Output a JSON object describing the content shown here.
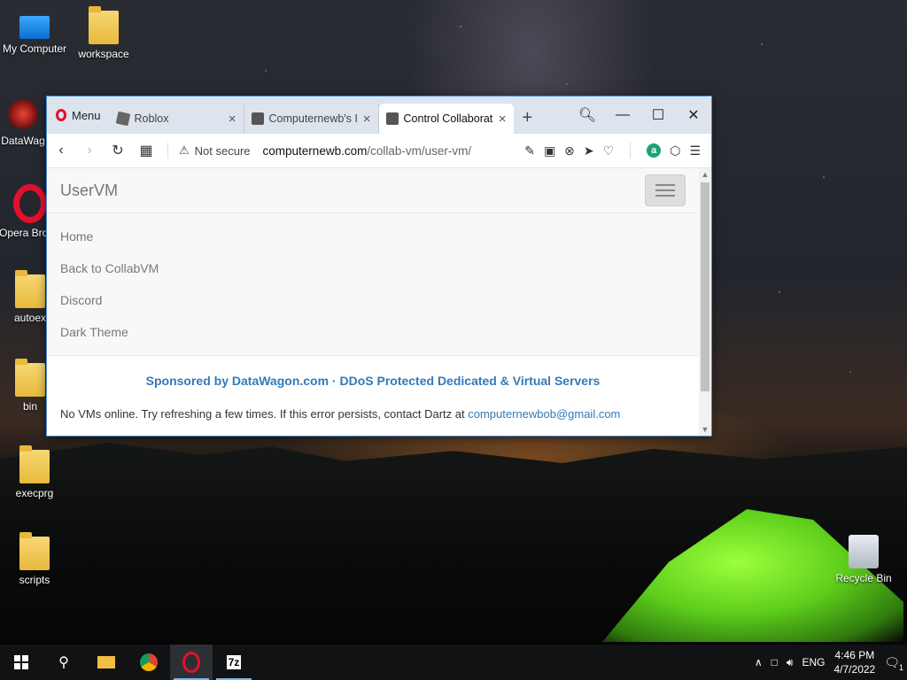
{
  "desktop": {
    "icons": [
      {
        "label": "My Computer"
      },
      {
        "label": "workspace"
      },
      {
        "label": "DataWag"
      },
      {
        "label": "Opera Brows"
      },
      {
        "label": "autoex"
      },
      {
        "label": "bin"
      },
      {
        "label": "execprg"
      },
      {
        "label": "scripts"
      },
      {
        "label": "Recycle Bin"
      }
    ]
  },
  "browser": {
    "menu_label": "Menu",
    "tabs": [
      {
        "title": "Roblox",
        "close": "×"
      },
      {
        "title": "Computernewb's I",
        "close": "×"
      },
      {
        "title": "Control Collaborat",
        "close": "×"
      }
    ],
    "new_tab": "+",
    "address": {
      "security": "Not secure",
      "domain": "computernewb.com",
      "path": "/collab-vm/user-vm/"
    },
    "ext_badge": "a"
  },
  "page": {
    "brand": "UserVM",
    "nav_links": [
      "Home",
      "Back to CollabVM",
      "Discord",
      "Dark Theme"
    ],
    "sponsor": "Sponsored by DataWagon.com · DDoS Protected Dedicated & Virtual Servers",
    "notice": "No VMs online. Try refreshing a few times. If this error persists, contact Dartz at ",
    "notice_email": "computernewbob@gmail.com"
  },
  "taskbar": {
    "lang": "ENG",
    "time": "4:46 PM",
    "date": "4/7/2022",
    "notif_count": "1",
    "sevenzip": "7z"
  },
  "colors": {
    "accent": "#337ab7",
    "opera_red": "#e3102d",
    "taskbar": "#101214"
  }
}
